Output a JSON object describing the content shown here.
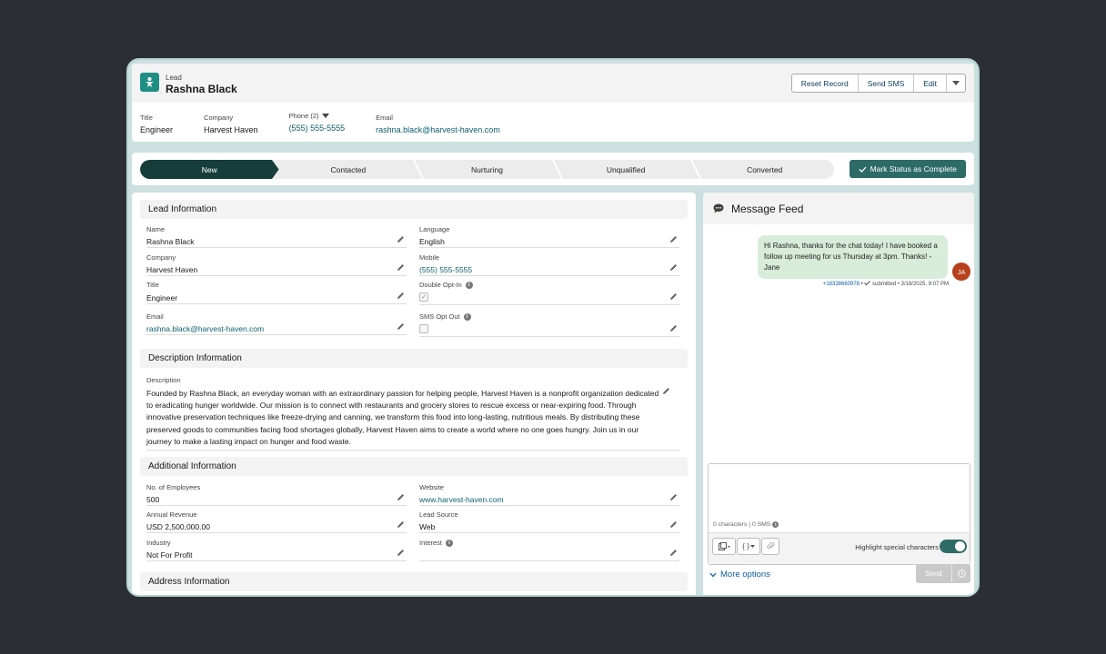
{
  "header": {
    "record_type": "Lead",
    "record_name": "Rashna Black",
    "buttons": {
      "reset": "Reset Record",
      "send_sms": "Send SMS",
      "edit": "Edit"
    },
    "fields": {
      "title_label": "Title",
      "title_value": "Engineer",
      "company_label": "Company",
      "company_value": "Harvest Haven",
      "phone_label": "Phone (2)",
      "phone_value": "(555) 555-5555",
      "email_label": "Email",
      "email_value": "rashna.black@harvest-haven.com"
    }
  },
  "path": {
    "steps": [
      "New",
      "Contacted",
      "Nurturing",
      "Unqualified",
      "Converted"
    ],
    "active_index": 0,
    "mark_button": "Mark Status as Complete"
  },
  "lead_info": {
    "section": "Lead Information",
    "name_label": "Name",
    "name_value": "Rashna Black",
    "language_label": "Language",
    "language_value": "English",
    "company_label": "Company",
    "company_value": "Harvest Haven",
    "mobile_label": "Mobile",
    "mobile_value": "(555) 555-5555",
    "title_label": "Title",
    "title_value": "Engineer",
    "double_opt_in_label": "Double Opt-In",
    "double_opt_in_checked": true,
    "email_label": "Email",
    "email_value": "rashna.black@harvest-haven.com",
    "sms_opt_out_label": "SMS Opt Out",
    "sms_opt_out_checked": false
  },
  "description_info": {
    "section": "Description Information",
    "label": "Description",
    "value": "Founded by Rashna Black, an everyday woman with an extraordinary passion for helping people, Harvest Haven is a nonprofit organization dedicated to eradicating hunger worldwide. Our mission is to connect with restaurants and grocery stores to rescue excess or near-expiring food. Through innovative preservation techniques like freeze-drying and canning, we transform this food into long-lasting, nutritious meals. By distributing these preserved goods to communities facing food shortages globally, Harvest Haven aims to create a world where no one goes hungry. Join us in our journey to make a lasting impact on hunger and food waste."
  },
  "additional_info": {
    "section": "Additional Information",
    "employees_label": "No. of Employees",
    "employees_value": "500",
    "website_label": "Website",
    "website_value": "www.harvest-haven.com",
    "revenue_label": "Annual Revenue",
    "revenue_value": "USD 2,500,000.00",
    "lead_source_label": "Lead Source",
    "lead_source_value": "Web",
    "industry_label": "Industry",
    "industry_value": "Not For Profit",
    "interest_label": "Interest",
    "interest_value": ""
  },
  "address_info": {
    "section": "Address Information"
  },
  "feed": {
    "title": "Message Feed",
    "message": "Hi Rashna, thanks for the chat today! I have booked a follow up meeting for us Thursday at 3pm. Thanks! - Jane",
    "avatar_initials": "JA",
    "meta_phone": "+18338660978",
    "meta_status": "submitted",
    "meta_time": "3/18/2025, 9:07 PM",
    "counter": "0 characters | 0 SMS",
    "template_tool": "{ }",
    "highlight_label": "Highlight special characters",
    "highlight_on": true,
    "more_options": "More options",
    "send": "Send"
  },
  "colors": {
    "brand": "#1f8f84",
    "path_active": "#173d3a",
    "primary_button": "#2d6b67",
    "link": "#0b5f6e",
    "bubble": "#d7ecd9",
    "avatar": "#b8401e"
  }
}
